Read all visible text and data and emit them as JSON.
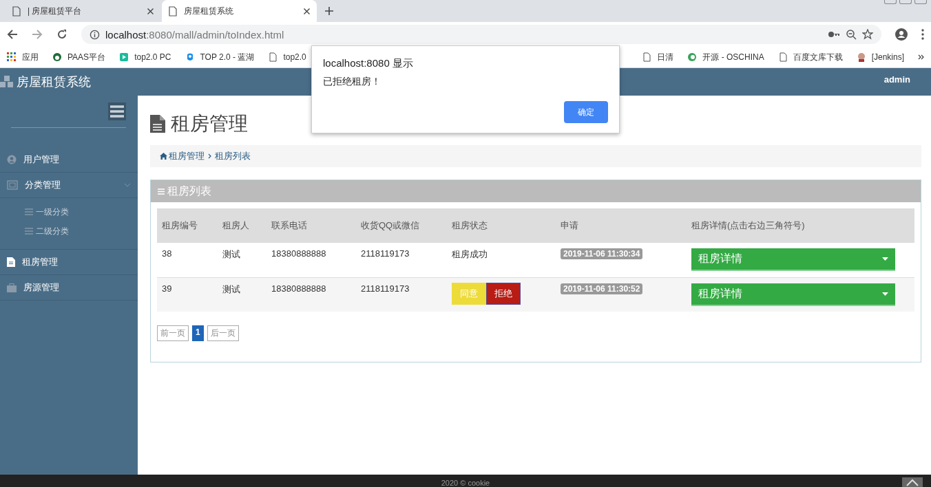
{
  "browser": {
    "tabs": [
      {
        "title": "| 房屋租赁平台",
        "selected": false
      },
      {
        "title": "房屋租赁系统",
        "selected": true
      }
    ],
    "address": {
      "host": "localhost",
      "path": ":8080/mall/admin/toIndex.html"
    },
    "bookmarks_left": [
      {
        "label": "应用"
      },
      {
        "label": "PAAS平台"
      },
      {
        "label": "top2.0 PC"
      },
      {
        "label": "TOP 2.0 - 蓝湖"
      },
      {
        "label": "top2.0"
      }
    ],
    "bookmarks_right": [
      {
        "label": "日清"
      },
      {
        "label": "开源 - OSCHINA"
      },
      {
        "label": "百度文库下载"
      },
      {
        "label": "[Jenkins]"
      }
    ]
  },
  "header": {
    "title": "房屋租赁系统",
    "user": "admin"
  },
  "sidebar": {
    "items": [
      {
        "label": "用户管理"
      },
      {
        "label": "分类管理",
        "children": [
          {
            "label": "一级分类"
          },
          {
            "label": "二级分类"
          }
        ]
      },
      {
        "label": "租房管理"
      },
      {
        "label": "房源管理"
      }
    ]
  },
  "page": {
    "title": "租房管理",
    "breadcrumb": [
      "租房管理",
      "租房列表"
    ]
  },
  "panel": {
    "title": "租房列表",
    "table": {
      "columns": [
        "租房编号",
        "租房人",
        "联系电话",
        "收货QQ或微信",
        "租房状态",
        "申请",
        "租房详情(点击右边三角符号)"
      ],
      "rows": [
        {
          "id": "38",
          "tenant": "测试",
          "phone": "18380888888",
          "contact": "2118119173",
          "status": {
            "kind": "text",
            "text": "租房成功"
          },
          "applied": "2019-11-06 11:30:34",
          "detail": "租房详情"
        },
        {
          "id": "39",
          "tenant": "测试",
          "phone": "18380888888",
          "contact": "2118119173",
          "status": {
            "kind": "actions",
            "buttons": [
              {
                "label": "同意",
                "color": "#eddb3a"
              },
              {
                "label": "拒绝",
                "color": "#b81c14"
              }
            ]
          },
          "applied": "2019-11-06 11:30:52",
          "detail": "租房详情"
        }
      ]
    },
    "pagination": {
      "prev": "前一页",
      "pages": [
        {
          "label": "1",
          "selected": true
        }
      ],
      "next": "后一页"
    }
  },
  "dialog": {
    "title": "localhost:8080 显示",
    "message": "已拒绝租房！",
    "ok": "确定"
  },
  "footer": {
    "text": "2020 © cookie"
  }
}
